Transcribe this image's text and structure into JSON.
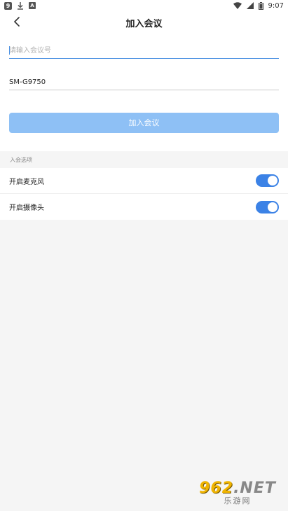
{
  "status_bar": {
    "time": "9:07",
    "icons": [
      "app-icon",
      "download-icon",
      "a-icon",
      "wifi-icon",
      "signal-icon",
      "battery-icon"
    ]
  },
  "header": {
    "title": "加入会议",
    "back_icon": "chevron-left-icon"
  },
  "form": {
    "meeting_id_placeholder": "请输入会议号",
    "meeting_id_value": "",
    "name_value": "SM-G9750",
    "join_label": "加入会议"
  },
  "options": {
    "section_title": "入会选项",
    "items": [
      {
        "label": "开启麦克风",
        "enabled": true
      },
      {
        "label": "开启摄像头",
        "enabled": true
      }
    ]
  },
  "watermark": {
    "logo": "962",
    "suffix": ".NET",
    "site": "乐游网"
  },
  "colors": {
    "accent": "#3b82e6",
    "join_disabled": "#8ec0f5",
    "background": "#f5f5f5"
  }
}
